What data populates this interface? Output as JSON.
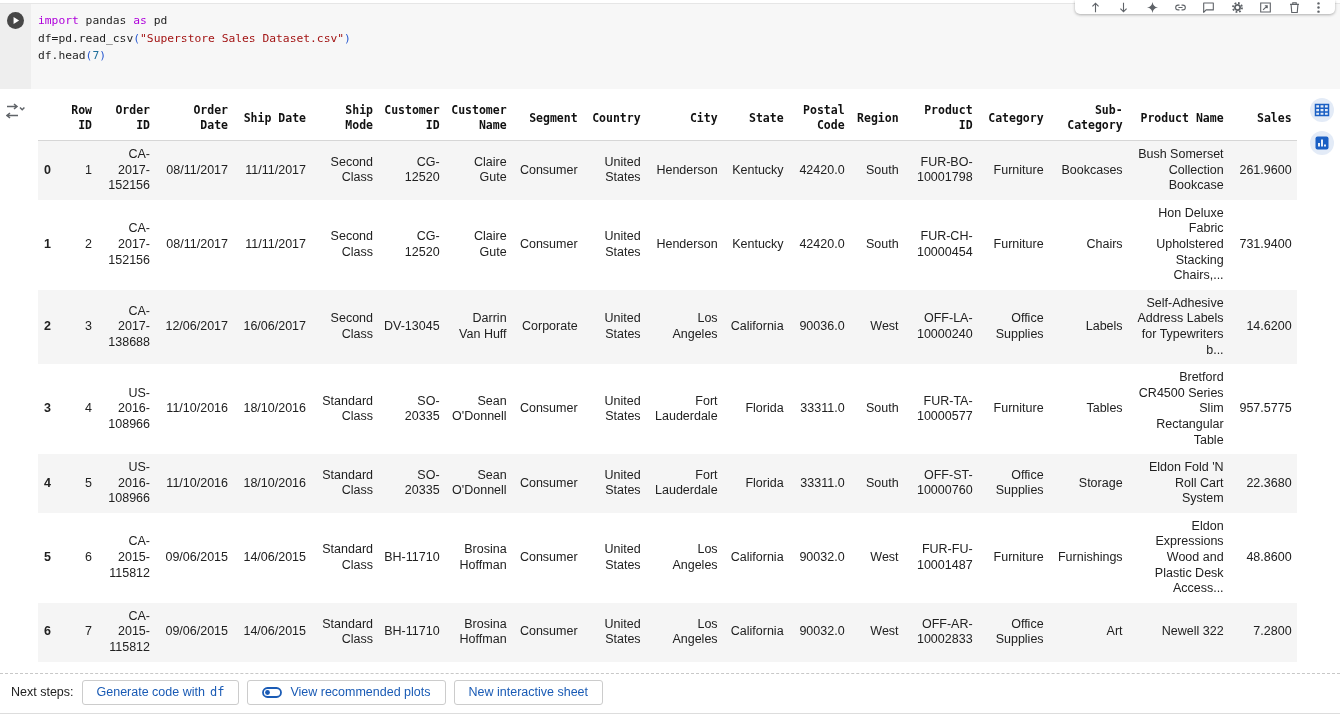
{
  "code_cell": {
    "lines": [
      {
        "tokens": [
          {
            "kind": "keyword",
            "text": "import"
          },
          {
            "kind": "plain",
            "text": " pandas "
          },
          {
            "kind": "keyword",
            "text": "as"
          },
          {
            "kind": "plain",
            "text": " pd"
          }
        ]
      },
      {
        "tokens": [
          {
            "kind": "plain",
            "text": "df=pd.read_csv"
          },
          {
            "kind": "bracket",
            "text": "("
          },
          {
            "kind": "string",
            "text": "\"Superstore Sales Dataset.csv\""
          },
          {
            "kind": "bracket",
            "text": ")"
          }
        ]
      },
      {
        "tokens": [
          {
            "kind": "plain",
            "text": "df.head"
          },
          {
            "kind": "bracket",
            "text": "("
          },
          {
            "kind": "number",
            "text": "7"
          },
          {
            "kind": "bracket",
            "text": ")"
          }
        ]
      }
    ]
  },
  "output": {
    "table": {
      "columns": [
        "Row ID",
        "Order ID",
        "Order Date",
        "Ship Date",
        "Ship Mode",
        "Customer ID",
        "Customer Name",
        "Segment",
        "Country",
        "City",
        "State",
        "Postal Code",
        "Region",
        "Product ID",
        "Category",
        "Sub-Category",
        "Product Name",
        "Sales"
      ],
      "rows": [
        {
          "index": "0",
          "cells": [
            "1",
            "CA-2017-152156",
            "08/11/2017",
            "11/11/2017",
            "Second Class",
            "CG-12520",
            "Claire Gute",
            "Consumer",
            "United States",
            "Henderson",
            "Kentucky",
            "42420.0",
            "South",
            "FUR-BO-10001798",
            "Furniture",
            "Bookcases",
            "Bush Somerset Collection Bookcase",
            "261.9600"
          ]
        },
        {
          "index": "1",
          "cells": [
            "2",
            "CA-2017-152156",
            "08/11/2017",
            "11/11/2017",
            "Second Class",
            "CG-12520",
            "Claire Gute",
            "Consumer",
            "United States",
            "Henderson",
            "Kentucky",
            "42420.0",
            "South",
            "FUR-CH-10000454",
            "Furniture",
            "Chairs",
            "Hon Deluxe Fabric Upholstered Stacking Chairs,...",
            "731.9400"
          ]
        },
        {
          "index": "2",
          "cells": [
            "3",
            "CA-2017-138688",
            "12/06/2017",
            "16/06/2017",
            "Second Class",
            "DV-13045",
            "Darrin Van Huff",
            "Corporate",
            "United States",
            "Los Angeles",
            "California",
            "90036.0",
            "West",
            "OFF-LA-10000240",
            "Office Supplies",
            "Labels",
            "Self-Adhesive Address Labels for Typewriters b...",
            "14.6200"
          ]
        },
        {
          "index": "3",
          "cells": [
            "4",
            "US-2016-108966",
            "11/10/2016",
            "18/10/2016",
            "Standard Class",
            "SO-20335",
            "Sean O'Donnell",
            "Consumer",
            "United States",
            "Fort Lauderdale",
            "Florida",
            "33311.0",
            "South",
            "FUR-TA-10000577",
            "Furniture",
            "Tables",
            "Bretford CR4500 Series Slim Rectangular Table",
            "957.5775"
          ]
        },
        {
          "index": "4",
          "cells": [
            "5",
            "US-2016-108966",
            "11/10/2016",
            "18/10/2016",
            "Standard Class",
            "SO-20335",
            "Sean O'Donnell",
            "Consumer",
            "United States",
            "Fort Lauderdale",
            "Florida",
            "33311.0",
            "South",
            "OFF-ST-10000760",
            "Office Supplies",
            "Storage",
            "Eldon Fold 'N Roll Cart System",
            "22.3680"
          ]
        },
        {
          "index": "5",
          "cells": [
            "6",
            "CA-2015-115812",
            "09/06/2015",
            "14/06/2015",
            "Standard Class",
            "BH-11710",
            "Brosina Hoffman",
            "Consumer",
            "United States",
            "Los Angeles",
            "California",
            "90032.0",
            "West",
            "FUR-FU-10001487",
            "Furniture",
            "Furnishings",
            "Eldon Expressions Wood and Plastic Desk Access...",
            "48.8600"
          ]
        },
        {
          "index": "6",
          "cells": [
            "7",
            "CA-2015-115812",
            "09/06/2015",
            "14/06/2015",
            "Standard Class",
            "BH-11710",
            "Brosina Hoffman",
            "Consumer",
            "United States",
            "Los Angeles",
            "California",
            "90032.0",
            "West",
            "OFF-AR-10002833",
            "Office Supplies",
            "Art",
            "Newell 322",
            "7.2800"
          ]
        }
      ]
    }
  },
  "next_steps": {
    "label": "Next steps:",
    "buttons": [
      {
        "kind": "code",
        "text": "Generate code with",
        "code": "df"
      },
      {
        "kind": "toggle",
        "text": "View recommended plots"
      },
      {
        "kind": "plain",
        "text": "New interactive sheet"
      }
    ]
  }
}
